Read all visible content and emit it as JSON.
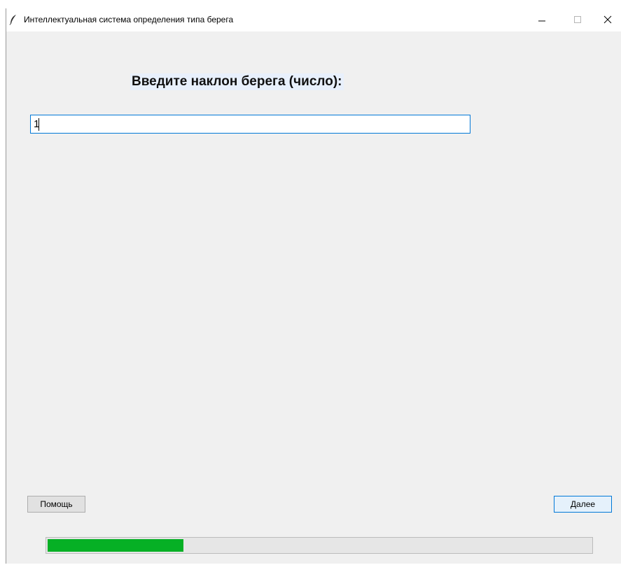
{
  "window": {
    "title": "Интеллектуальная система определения типа берега",
    "icon": "feather-icon",
    "controls": [
      "minimize-icon",
      "maximize-icon",
      "close-icon"
    ]
  },
  "form": {
    "prompt": "Введите наклон берега (число):",
    "input_value": "1",
    "input_placeholder": ""
  },
  "buttons": {
    "help_label": "Помощь",
    "next_label": "Далее"
  },
  "progress": {
    "value_percent": 25,
    "color": "#06b025"
  },
  "colors": {
    "background": "#f0f0f0",
    "accent": "#0078d7",
    "heading_highlight": "#e8f0fc"
  }
}
